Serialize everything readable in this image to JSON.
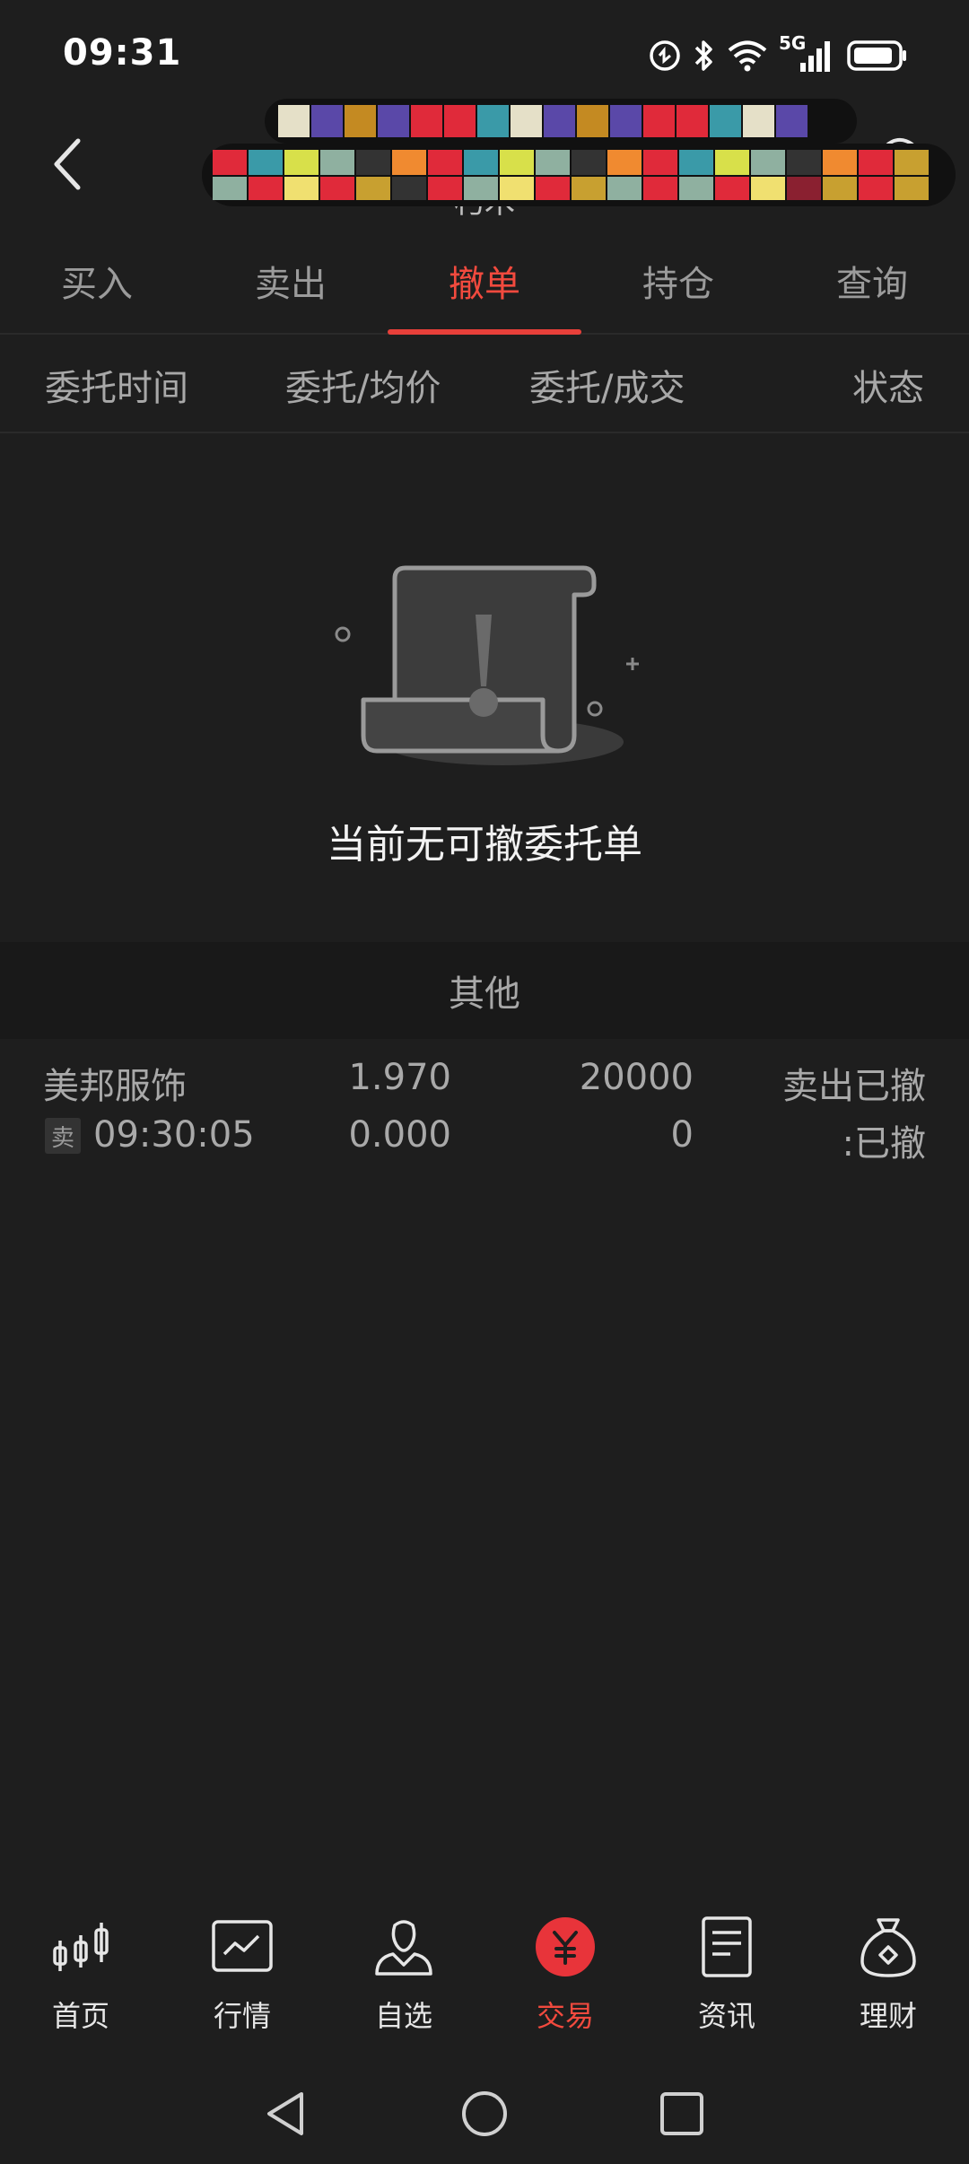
{
  "status_bar": {
    "time": "09:31",
    "network_label": "5G",
    "icons": [
      "data-saver-icon",
      "bluetooth-icon",
      "wifi-icon",
      "signal-5g-icon",
      "battery-icon"
    ]
  },
  "header": {
    "subtitle": "朽木",
    "back_icon": "chevron-left-icon",
    "refresh_icon": "refresh-icon"
  },
  "tabs": [
    {
      "label": "买入",
      "active": false
    },
    {
      "label": "卖出",
      "active": false
    },
    {
      "label": "撤单",
      "active": true
    },
    {
      "label": "持仓",
      "active": false
    },
    {
      "label": "查询",
      "active": false
    }
  ],
  "columns": [
    "委托时间",
    "委托/均价",
    "委托/成交",
    "状态"
  ],
  "empty_state": {
    "message": "当前无可撤委托单",
    "icon": "empty-document-icon"
  },
  "section_other": {
    "label": "其他"
  },
  "orders": [
    {
      "name": "美邦服饰",
      "side_tag": "卖",
      "time": "09:30:05",
      "order_price": "1.970",
      "avg_price": "0.000",
      "order_qty": "20000",
      "filled_qty": "0",
      "status_line1": "卖出已撤",
      "status_line2": ":已撤"
    }
  ],
  "bottom_nav": [
    {
      "label": "首页",
      "icon": "candlestick-icon",
      "active": false
    },
    {
      "label": "行情",
      "icon": "market-chart-icon",
      "active": false
    },
    {
      "label": "自选",
      "icon": "person-check-icon",
      "active": false
    },
    {
      "label": "交易",
      "icon": "yuan-icon",
      "active": true
    },
    {
      "label": "资讯",
      "icon": "document-icon",
      "active": false
    },
    {
      "label": "理财",
      "icon": "money-bag-icon",
      "active": false
    }
  ],
  "system_nav": {
    "back_icon": "triangle-back-icon",
    "home_icon": "circle-home-icon",
    "recents_icon": "square-recents-icon"
  },
  "colors": {
    "background": "#1e1e1e",
    "accent": "#e8403a",
    "text_primary": "#e6e6e6",
    "text_muted": "#a8a8a8"
  }
}
